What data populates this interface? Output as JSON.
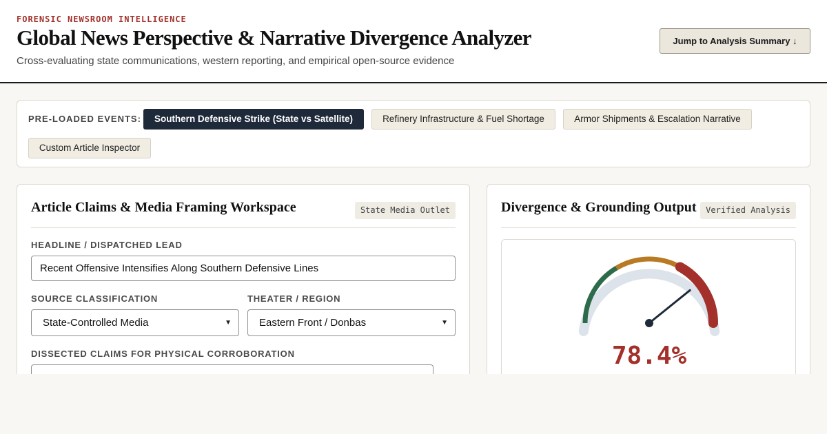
{
  "header": {
    "kicker": "FORENSIC NEWSROOM INTELLIGENCE",
    "title": "Global News Perspective & Narrative Divergence Analyzer",
    "subtitle": "Cross-evaluating state communications, western reporting, and empirical open-source evidence",
    "jump_button": "Jump to Analysis Summary ↓"
  },
  "events": {
    "label": "PRE-LOADED EVENTS:",
    "items": [
      {
        "label": "Southern Defensive Strike (State vs Satellite)",
        "active": true
      },
      {
        "label": "Refinery Infrastructure & Fuel Shortage",
        "active": false
      },
      {
        "label": "Armor Shipments & Escalation Narrative",
        "active": false
      },
      {
        "label": "Custom Article Inspector",
        "active": false
      }
    ]
  },
  "workspace": {
    "title": "Article Claims & Media Framing Workspace",
    "tag": "State Media Outlet",
    "headline_label": "HEADLINE / DISPATCHED LEAD",
    "headline_value": "Recent Offensive Intensifies Along Southern Defensive Lines",
    "source_label": "SOURCE CLASSIFICATION",
    "source_value": "State-Controlled Media",
    "theater_label": "THEATER / REGION",
    "theater_value": "Eastern Front / Donbas",
    "claims_label": "DISSECTED CLAIMS FOR PHYSICAL CORROBORATION"
  },
  "output": {
    "title": "Divergence & Grounding Output",
    "tag": "Verified Analysis",
    "divergence_percent": 78.4,
    "divergence_display": "78.4%",
    "colors": {
      "track": "#dde3ea",
      "low": "#2e6b4a",
      "mid": "#b87a23",
      "high": "#a3302a",
      "needle": "#1e2a3a"
    }
  }
}
